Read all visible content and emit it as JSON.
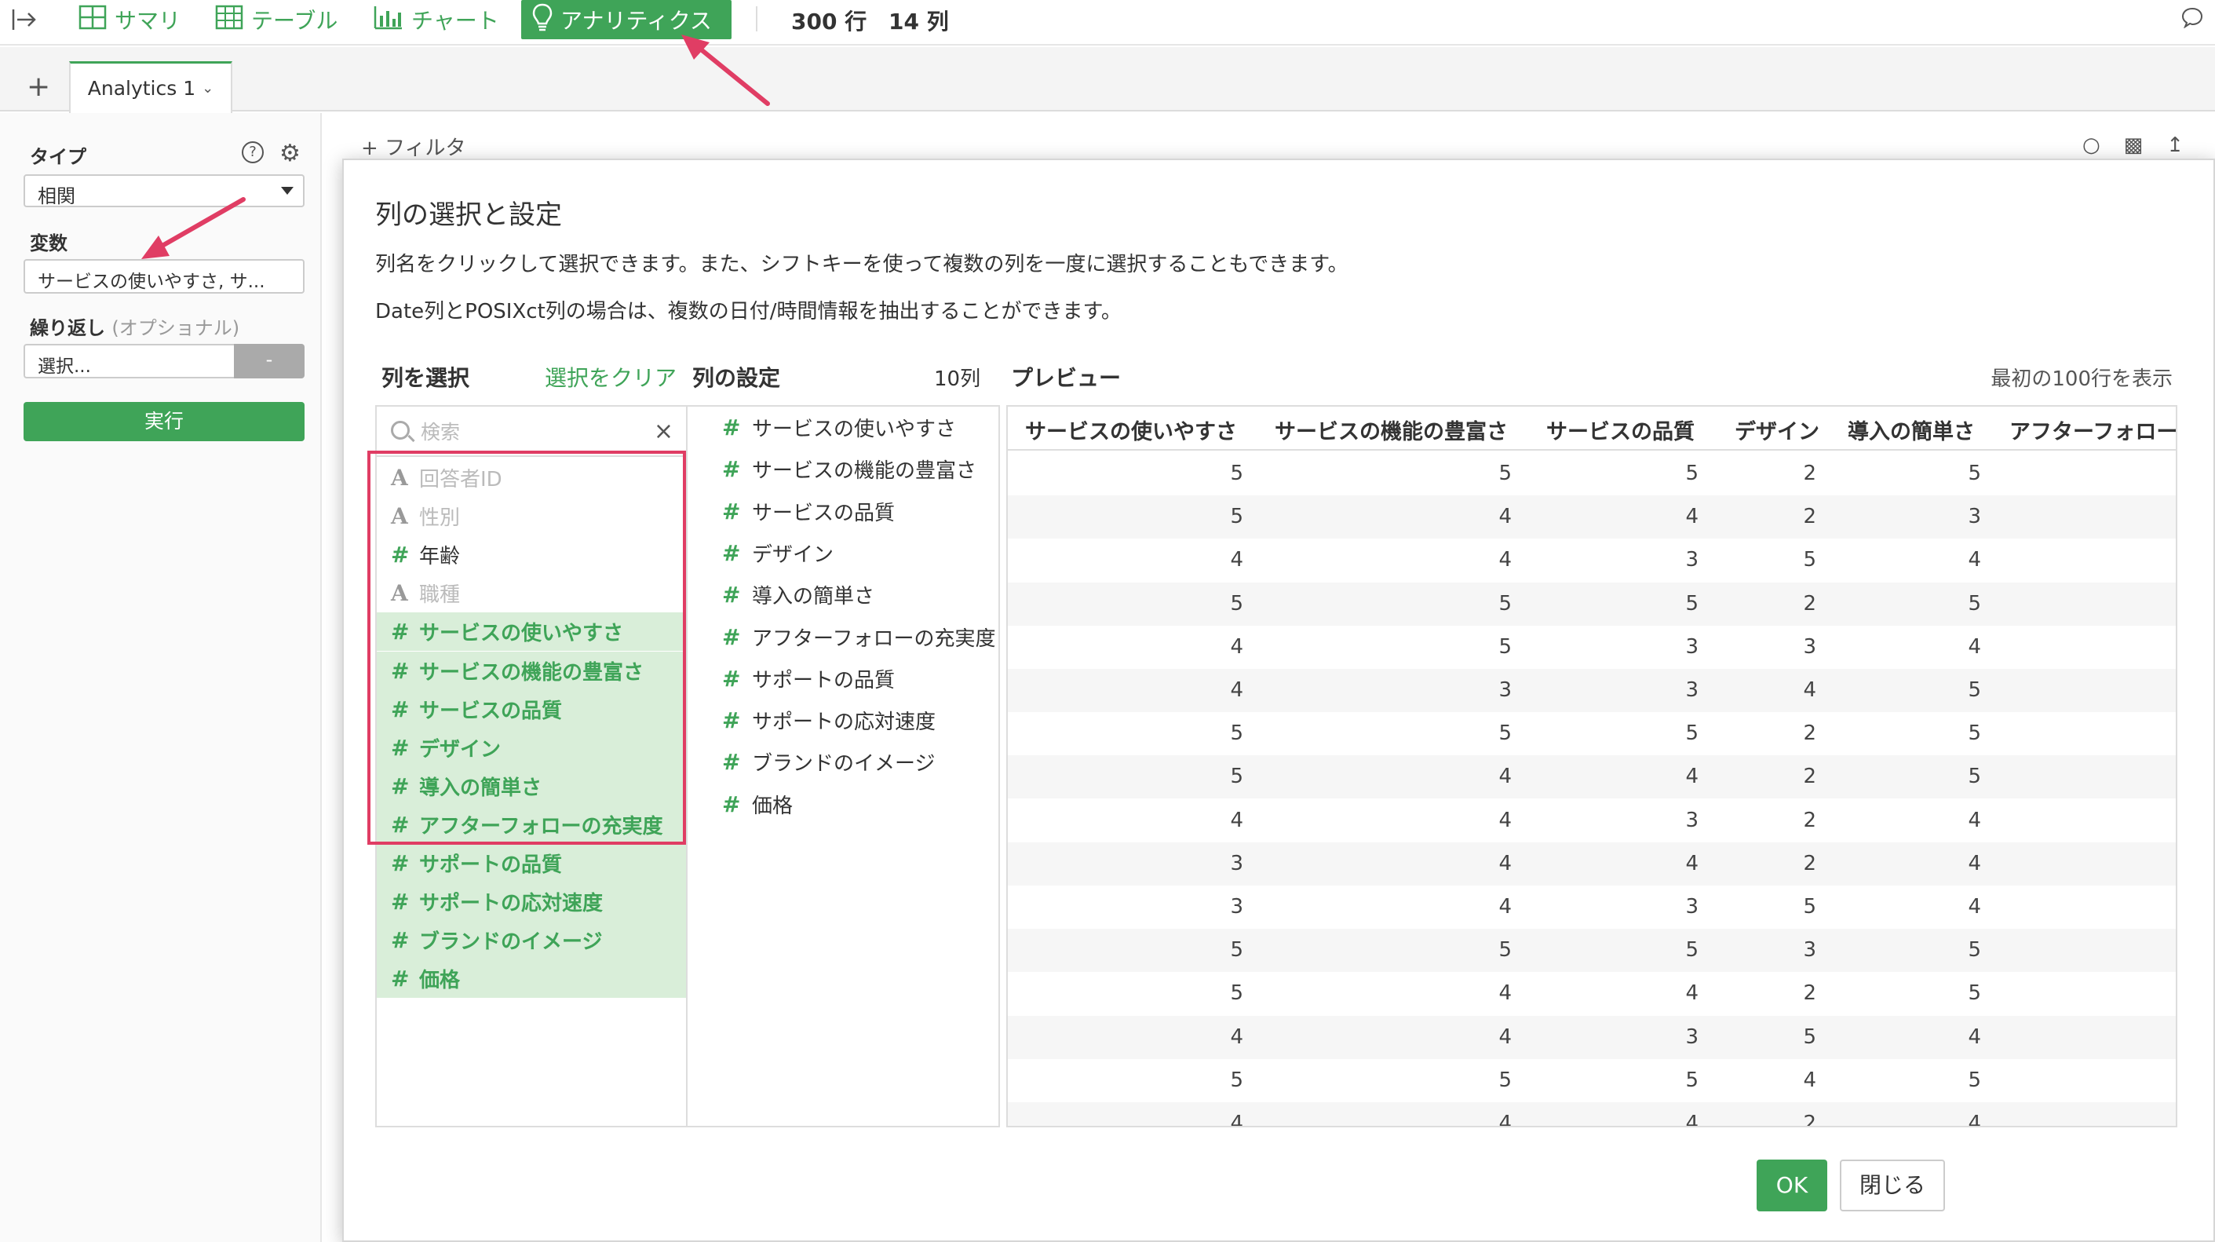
{
  "toolbar": {
    "collapse_icon": "collapse-right-icon",
    "tabs": [
      {
        "label": "サマリ",
        "icon": "grid-icon"
      },
      {
        "label": "テーブル",
        "icon": "table-icon"
      },
      {
        "label": "チャート",
        "icon": "bar-chart-icon"
      },
      {
        "label": "アナリティクス",
        "icon": "lightbulb-icon",
        "active": true
      }
    ],
    "rows_text": "300 行",
    "cols_text": "14 列"
  },
  "tabs": {
    "add_label": "+",
    "active_tab": "Analytics 1"
  },
  "left_panel": {
    "type_label": "タイプ",
    "type_value": "相関",
    "variables_label": "変数",
    "variables_value": "サービスの使いやすさ, サ...",
    "repeat_label": "繰り返し",
    "repeat_optional": "(オプショナル)",
    "repeat_value": "選択...",
    "repeat_button": "-",
    "run_button": "実行"
  },
  "main": {
    "filter_label": "+ フィルタ"
  },
  "dialog": {
    "title": "列の選択と設定",
    "description1": "列名をクリックして選択できます。また、シフトキーを使って複数の列を一度に選択することもできます。",
    "description2": "Date列とPOSIXct列の場合は、複数の日付/時間情報を抽出することができます。",
    "select_header": "列を選択",
    "clear_selection": "選択をクリア",
    "settings_header": "列の設定",
    "settings_count": "10列",
    "preview_header": "プレビュー",
    "preview_rowinfo": "最初の100行を表示",
    "search_placeholder": "検索",
    "search_clear": "×",
    "columns": [
      {
        "type": "A",
        "label": "回答者ID",
        "kind": "char",
        "selected": false
      },
      {
        "type": "A",
        "label": "性別",
        "kind": "char",
        "selected": false
      },
      {
        "type": "#",
        "label": "年齢",
        "kind": "num",
        "selected": false
      },
      {
        "type": "A",
        "label": "職種",
        "kind": "char",
        "selected": false
      },
      {
        "type": "#",
        "label": "サービスの使いやすさ",
        "kind": "num",
        "selected": true
      },
      {
        "type": "#",
        "label": "サービスの機能の豊富さ",
        "kind": "num",
        "selected": true
      },
      {
        "type": "#",
        "label": "サービスの品質",
        "kind": "num",
        "selected": true
      },
      {
        "type": "#",
        "label": "デザイン",
        "kind": "num",
        "selected": true
      },
      {
        "type": "#",
        "label": "導入の簡単さ",
        "kind": "num",
        "selected": true
      },
      {
        "type": "#",
        "label": "アフターフォローの充実度",
        "kind": "num",
        "selected": true
      },
      {
        "type": "#",
        "label": "サポートの品質",
        "kind": "num",
        "selected": true
      },
      {
        "type": "#",
        "label": "サポートの応対速度",
        "kind": "num",
        "selected": true
      },
      {
        "type": "#",
        "label": "ブランドのイメージ",
        "kind": "num",
        "selected": true
      },
      {
        "type": "#",
        "label": "価格",
        "kind": "num",
        "selected": true
      }
    ],
    "settings": [
      "サービスの使いやすさ",
      "サービスの機能の豊富さ",
      "サービスの品質",
      "デザイン",
      "導入の簡単さ",
      "アフターフォローの充実度",
      "サポートの品質",
      "サポートの応対速度",
      "ブランドのイメージ",
      "価格"
    ],
    "preview_columns": [
      "サービスの使いやすさ",
      "サービスの機能の豊富さ",
      "サービスの品質",
      "デザイン",
      "導入の簡単さ",
      "アフターフォロー"
    ],
    "preview_rows": [
      [
        5,
        5,
        5,
        2,
        5
      ],
      [
        5,
        4,
        4,
        2,
        3
      ],
      [
        4,
        4,
        3,
        5,
        4
      ],
      [
        5,
        5,
        5,
        2,
        5
      ],
      [
        4,
        5,
        3,
        3,
        4
      ],
      [
        4,
        3,
        3,
        4,
        5
      ],
      [
        5,
        5,
        5,
        2,
        5
      ],
      [
        5,
        4,
        4,
        2,
        5
      ],
      [
        4,
        4,
        3,
        2,
        4
      ],
      [
        3,
        4,
        4,
        2,
        4
      ],
      [
        3,
        4,
        3,
        5,
        4
      ],
      [
        5,
        5,
        5,
        3,
        5
      ],
      [
        5,
        4,
        4,
        2,
        5
      ],
      [
        4,
        4,
        3,
        5,
        4
      ],
      [
        5,
        5,
        5,
        4,
        5
      ],
      [
        4,
        4,
        4,
        2,
        4
      ]
    ],
    "ok_button": "OK",
    "close_button": "閉じる"
  },
  "colors": {
    "accent": "#3fa458",
    "highlight_border": "#e03d64",
    "selected_bg": "#d9eed9"
  }
}
